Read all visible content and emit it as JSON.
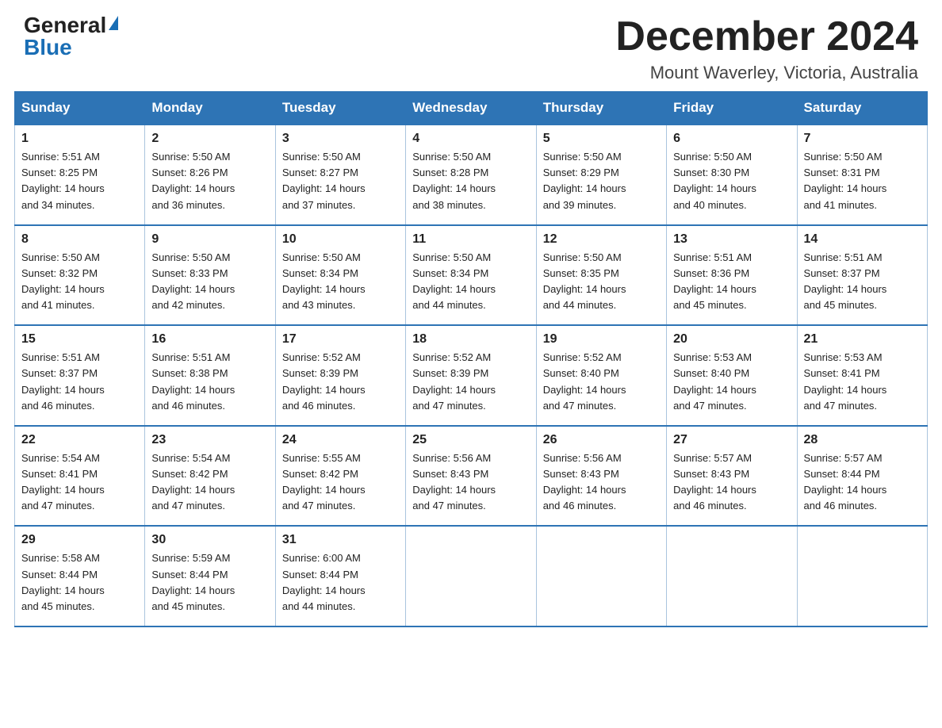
{
  "logo": {
    "general": "General",
    "blue": "Blue"
  },
  "title": "December 2024",
  "subtitle": "Mount Waverley, Victoria, Australia",
  "days_header": [
    "Sunday",
    "Monday",
    "Tuesday",
    "Wednesday",
    "Thursday",
    "Friday",
    "Saturday"
  ],
  "weeks": [
    [
      {
        "day": "1",
        "sunrise": "5:51 AM",
        "sunset": "8:25 PM",
        "daylight": "14 hours and 34 minutes."
      },
      {
        "day": "2",
        "sunrise": "5:50 AM",
        "sunset": "8:26 PM",
        "daylight": "14 hours and 36 minutes."
      },
      {
        "day": "3",
        "sunrise": "5:50 AM",
        "sunset": "8:27 PM",
        "daylight": "14 hours and 37 minutes."
      },
      {
        "day": "4",
        "sunrise": "5:50 AM",
        "sunset": "8:28 PM",
        "daylight": "14 hours and 38 minutes."
      },
      {
        "day": "5",
        "sunrise": "5:50 AM",
        "sunset": "8:29 PM",
        "daylight": "14 hours and 39 minutes."
      },
      {
        "day": "6",
        "sunrise": "5:50 AM",
        "sunset": "8:30 PM",
        "daylight": "14 hours and 40 minutes."
      },
      {
        "day": "7",
        "sunrise": "5:50 AM",
        "sunset": "8:31 PM",
        "daylight": "14 hours and 41 minutes."
      }
    ],
    [
      {
        "day": "8",
        "sunrise": "5:50 AM",
        "sunset": "8:32 PM",
        "daylight": "14 hours and 41 minutes."
      },
      {
        "day": "9",
        "sunrise": "5:50 AM",
        "sunset": "8:33 PM",
        "daylight": "14 hours and 42 minutes."
      },
      {
        "day": "10",
        "sunrise": "5:50 AM",
        "sunset": "8:34 PM",
        "daylight": "14 hours and 43 minutes."
      },
      {
        "day": "11",
        "sunrise": "5:50 AM",
        "sunset": "8:34 PM",
        "daylight": "14 hours and 44 minutes."
      },
      {
        "day": "12",
        "sunrise": "5:50 AM",
        "sunset": "8:35 PM",
        "daylight": "14 hours and 44 minutes."
      },
      {
        "day": "13",
        "sunrise": "5:51 AM",
        "sunset": "8:36 PM",
        "daylight": "14 hours and 45 minutes."
      },
      {
        "day": "14",
        "sunrise": "5:51 AM",
        "sunset": "8:37 PM",
        "daylight": "14 hours and 45 minutes."
      }
    ],
    [
      {
        "day": "15",
        "sunrise": "5:51 AM",
        "sunset": "8:37 PM",
        "daylight": "14 hours and 46 minutes."
      },
      {
        "day": "16",
        "sunrise": "5:51 AM",
        "sunset": "8:38 PM",
        "daylight": "14 hours and 46 minutes."
      },
      {
        "day": "17",
        "sunrise": "5:52 AM",
        "sunset": "8:39 PM",
        "daylight": "14 hours and 46 minutes."
      },
      {
        "day": "18",
        "sunrise": "5:52 AM",
        "sunset": "8:39 PM",
        "daylight": "14 hours and 47 minutes."
      },
      {
        "day": "19",
        "sunrise": "5:52 AM",
        "sunset": "8:40 PM",
        "daylight": "14 hours and 47 minutes."
      },
      {
        "day": "20",
        "sunrise": "5:53 AM",
        "sunset": "8:40 PM",
        "daylight": "14 hours and 47 minutes."
      },
      {
        "day": "21",
        "sunrise": "5:53 AM",
        "sunset": "8:41 PM",
        "daylight": "14 hours and 47 minutes."
      }
    ],
    [
      {
        "day": "22",
        "sunrise": "5:54 AM",
        "sunset": "8:41 PM",
        "daylight": "14 hours and 47 minutes."
      },
      {
        "day": "23",
        "sunrise": "5:54 AM",
        "sunset": "8:42 PM",
        "daylight": "14 hours and 47 minutes."
      },
      {
        "day": "24",
        "sunrise": "5:55 AM",
        "sunset": "8:42 PM",
        "daylight": "14 hours and 47 minutes."
      },
      {
        "day": "25",
        "sunrise": "5:56 AM",
        "sunset": "8:43 PM",
        "daylight": "14 hours and 47 minutes."
      },
      {
        "day": "26",
        "sunrise": "5:56 AM",
        "sunset": "8:43 PM",
        "daylight": "14 hours and 46 minutes."
      },
      {
        "day": "27",
        "sunrise": "5:57 AM",
        "sunset": "8:43 PM",
        "daylight": "14 hours and 46 minutes."
      },
      {
        "day": "28",
        "sunrise": "5:57 AM",
        "sunset": "8:44 PM",
        "daylight": "14 hours and 46 minutes."
      }
    ],
    [
      {
        "day": "29",
        "sunrise": "5:58 AM",
        "sunset": "8:44 PM",
        "daylight": "14 hours and 45 minutes."
      },
      {
        "day": "30",
        "sunrise": "5:59 AM",
        "sunset": "8:44 PM",
        "daylight": "14 hours and 45 minutes."
      },
      {
        "day": "31",
        "sunrise": "6:00 AM",
        "sunset": "8:44 PM",
        "daylight": "14 hours and 44 minutes."
      },
      null,
      null,
      null,
      null
    ]
  ]
}
